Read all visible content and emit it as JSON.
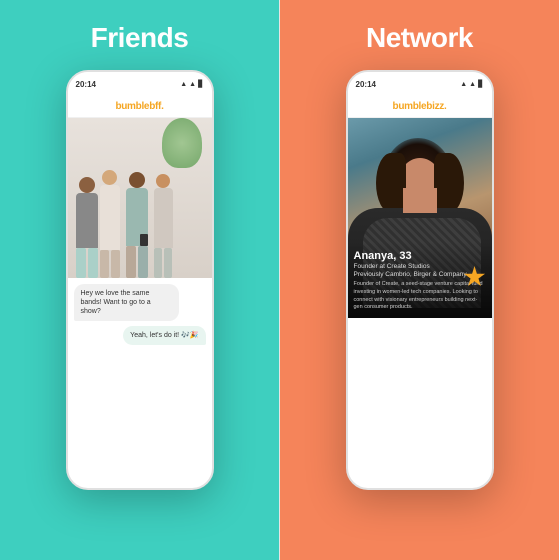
{
  "panels": {
    "friends": {
      "title": "Friends",
      "background": "#3ecfbf",
      "phone": {
        "time": "20:14",
        "appName": "bumblebff.",
        "chat": {
          "received": "Hey we love the same bands! Want to go to a show?",
          "sent": "Yeah, let's do it! 🎶🎉"
        }
      }
    },
    "network": {
      "title": "Network",
      "background": "#f5845a",
      "phone": {
        "time": "20:14",
        "appName": "bumblebizz.",
        "profile": {
          "name": "Ananya, 33",
          "title": "Founder at Create Studios",
          "subtitle": "Previously Cambrio, Birger & Company",
          "description": "Founder of Create, a seed-stage venture capital fund investing in women-led tech companies. Looking to connect with visionary entrepreneurs building next-gen consumer products."
        }
      }
    }
  }
}
